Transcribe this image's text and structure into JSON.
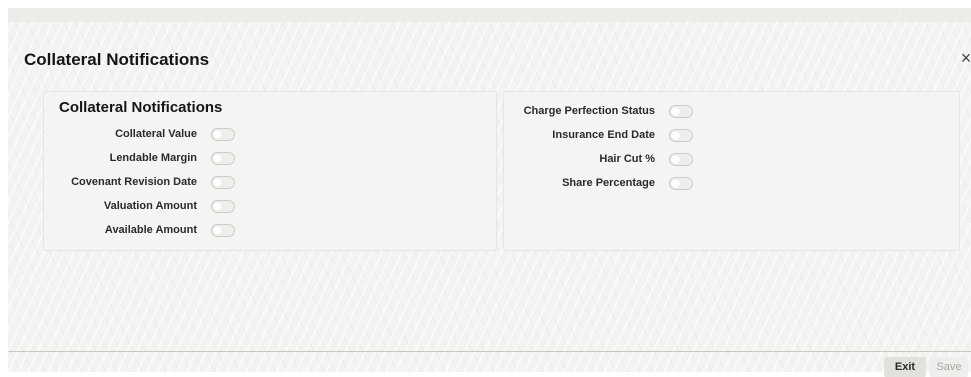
{
  "dialog": {
    "title": "Collateral Notifications",
    "close_glyph": "×"
  },
  "left_panel": {
    "title": "Collateral Notifications",
    "fields": [
      {
        "label": "Collateral Value",
        "checked": false
      },
      {
        "label": "Lendable Margin",
        "checked": false
      },
      {
        "label": "Covenant Revision Date",
        "checked": false
      },
      {
        "label": "Valuation Amount",
        "checked": false
      },
      {
        "label": "Available Amount",
        "checked": false
      }
    ]
  },
  "right_panel": {
    "fields": [
      {
        "label": "Charge Perfection Status",
        "checked": false
      },
      {
        "label": "Insurance End Date",
        "checked": false
      },
      {
        "label": "Hair Cut %",
        "checked": false
      },
      {
        "label": "Share Percentage",
        "checked": false
      }
    ]
  },
  "footer": {
    "exit_label": "Exit",
    "save_label": "Save"
  }
}
